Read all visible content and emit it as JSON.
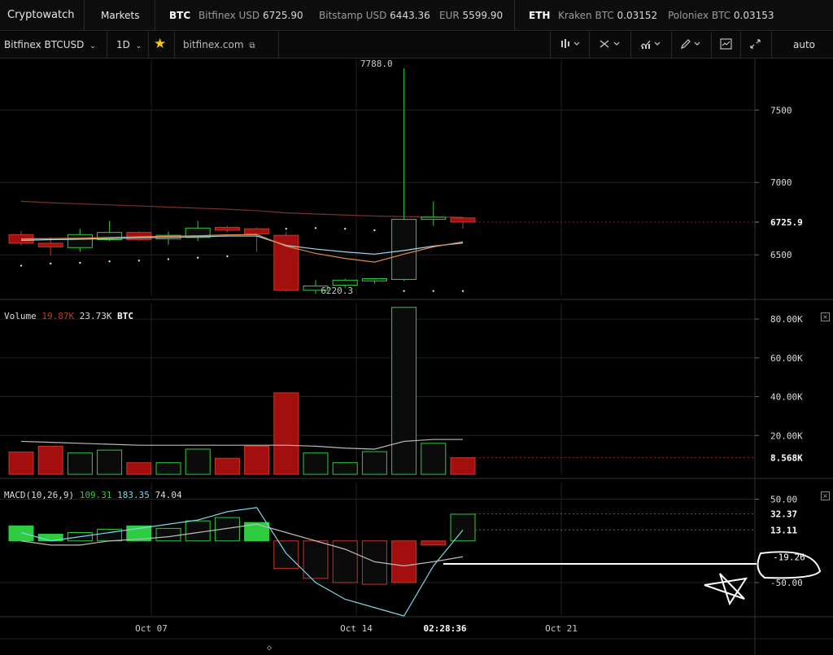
{
  "topbar": {
    "brand": "Cryptowatch",
    "markets": "Markets",
    "btc": {
      "symbol": "BTC",
      "items": [
        {
          "name": "Bitfinex USD",
          "value": "6725.90"
        },
        {
          "name": "Bitstamp USD",
          "value": "6443.36"
        },
        {
          "name": "EUR",
          "value": "5599.90"
        }
      ]
    },
    "eth": {
      "symbol": "ETH",
      "items": [
        {
          "name": "Kraken BTC",
          "value": "0.03152"
        },
        {
          "name": "Poloniex BTC",
          "value": "0.03153"
        }
      ]
    }
  },
  "toolbar": {
    "market": "Bitfinex BTCUSD",
    "period": "1D",
    "exchange_link": "bitfinex.com",
    "auto": "auto",
    "icons": [
      "chart-type-icon",
      "crosshair-icon",
      "indicators-icon",
      "draw-icon",
      "screenshot-icon",
      "fullscreen-icon"
    ]
  },
  "price_pane": {
    "high_label": "7788.0",
    "low_label": "6220.3",
    "last_price": "6725.9",
    "axis_ticks": [
      "7500",
      "7000",
      "6500"
    ]
  },
  "volume_pane": {
    "title": "Volume",
    "value_red": "19.87K",
    "value_white": "23.73K",
    "unit": "BTC",
    "axis_ticks": [
      "80.00K",
      "60.00K",
      "40.00K",
      "20.00K"
    ],
    "last_volume": "8.568K"
  },
  "macd_pane": {
    "title": "MACD(10,26,9)",
    "value_green": "109.31",
    "value_blue": "183.35",
    "value_white": "74.04",
    "axis_ticks": [
      "50.00",
      "-50.00"
    ],
    "label_macd": "32.37",
    "label_signal": "13.11",
    "label_hist": "-19.26"
  },
  "time_axis": {
    "labels": [
      "Oct 07",
      "Oct 14",
      "02:28:36",
      "Oct 21"
    ]
  },
  "chart_data": {
    "type": "candlestick",
    "price": {
      "ylim": [
        6220,
        7850
      ],
      "candles": [
        {
          "o": 6640,
          "h": 6665,
          "l": 6565,
          "c": 6580
        },
        {
          "o": 6580,
          "h": 6620,
          "l": 6495,
          "c": 6555
        },
        {
          "o": 6550,
          "h": 6680,
          "l": 6520,
          "c": 6640
        },
        {
          "o": 6605,
          "h": 6735,
          "l": 6595,
          "c": 6655
        },
        {
          "o": 6655,
          "h": 6665,
          "l": 6595,
          "c": 6605
        },
        {
          "o": 6610,
          "h": 6660,
          "l": 6570,
          "c": 6635
        },
        {
          "o": 6620,
          "h": 6735,
          "l": 6595,
          "c": 6685
        },
        {
          "o": 6690,
          "h": 6700,
          "l": 6655,
          "c": 6670
        },
        {
          "o": 6680,
          "h": 6690,
          "l": 6520,
          "c": 6645
        },
        {
          "o": 6635,
          "h": 6660,
          "l": 6245,
          "c": 6255
        },
        {
          "o": 6255,
          "h": 6325,
          "l": 6230,
          "c": 6285
        },
        {
          "o": 6290,
          "h": 6335,
          "l": 6270,
          "c": 6325
        },
        {
          "o": 6320,
          "h": 6340,
          "l": 6300,
          "c": 6335
        },
        {
          "o": 6330,
          "h": 7788,
          "l": 6320,
          "c": 6745
        },
        {
          "o": 6745,
          "h": 6870,
          "l": 6700,
          "c": 6760
        },
        {
          "o": 6755,
          "h": 6760,
          "l": 6680,
          "c": 6726
        }
      ],
      "ma_red": [
        6870,
        6860,
        6852,
        6845,
        6838,
        6830,
        6822,
        6815,
        6805,
        6790,
        6782,
        6775,
        6768,
        6764,
        6761,
        6760
      ],
      "ma_blue": [
        6600,
        6605,
        6608,
        6612,
        6618,
        6620,
        6625,
        6630,
        6630,
        6565,
        6540,
        6520,
        6505,
        6530,
        6560,
        6582
      ],
      "ma_orange": [
        6610,
        6612,
        6615,
        6620,
        6625,
        6628,
        6632,
        6638,
        6640,
        6560,
        6510,
        6475,
        6450,
        6505,
        6555,
        6590
      ],
      "dots_upper": [
        null,
        null,
        null,
        null,
        null,
        null,
        null,
        null,
        null,
        6680,
        6685,
        6680,
        6670,
        null,
        null,
        null
      ],
      "dots_lower": [
        6425,
        6440,
        6445,
        6455,
        6460,
        6470,
        6480,
        6490,
        null,
        null,
        null,
        null,
        null,
        6250,
        6250,
        6250
      ]
    },
    "volume": {
      "ylim": [
        0,
        88000
      ],
      "values": [
        11500,
        14500,
        11000,
        12500,
        6000,
        6000,
        13000,
        8300,
        14500,
        42000,
        11000,
        6000,
        11700,
        86000,
        16000,
        8568
      ],
      "direction": [
        "down",
        "down",
        "up",
        "up",
        "down",
        "up",
        "up",
        "down",
        "down",
        "down",
        "up",
        "up",
        "up",
        "up",
        "up",
        "down"
      ],
      "ma": [
        17000,
        16500,
        16000,
        15500,
        15000,
        15000,
        15000,
        15000,
        15000,
        15000,
        14500,
        13500,
        13000,
        17000,
        18000,
        18000
      ]
    },
    "macd": {
      "ylim": [
        -90,
        70
      ],
      "histogram": [
        18,
        8,
        10,
        14,
        18,
        15,
        24,
        28,
        22,
        -33,
        -45,
        -50,
        -52,
        -50,
        -5,
        32
      ],
      "macd_line": [
        10,
        0,
        5,
        10,
        15,
        20,
        25,
        35,
        40,
        -15,
        -50,
        -70,
        -80,
        -90,
        -30,
        13
      ],
      "signal_line": [
        0,
        -5,
        -5,
        0,
        2,
        5,
        10,
        15,
        20,
        10,
        0,
        -10,
        -25,
        -30,
        -25,
        -19
      ]
    }
  }
}
